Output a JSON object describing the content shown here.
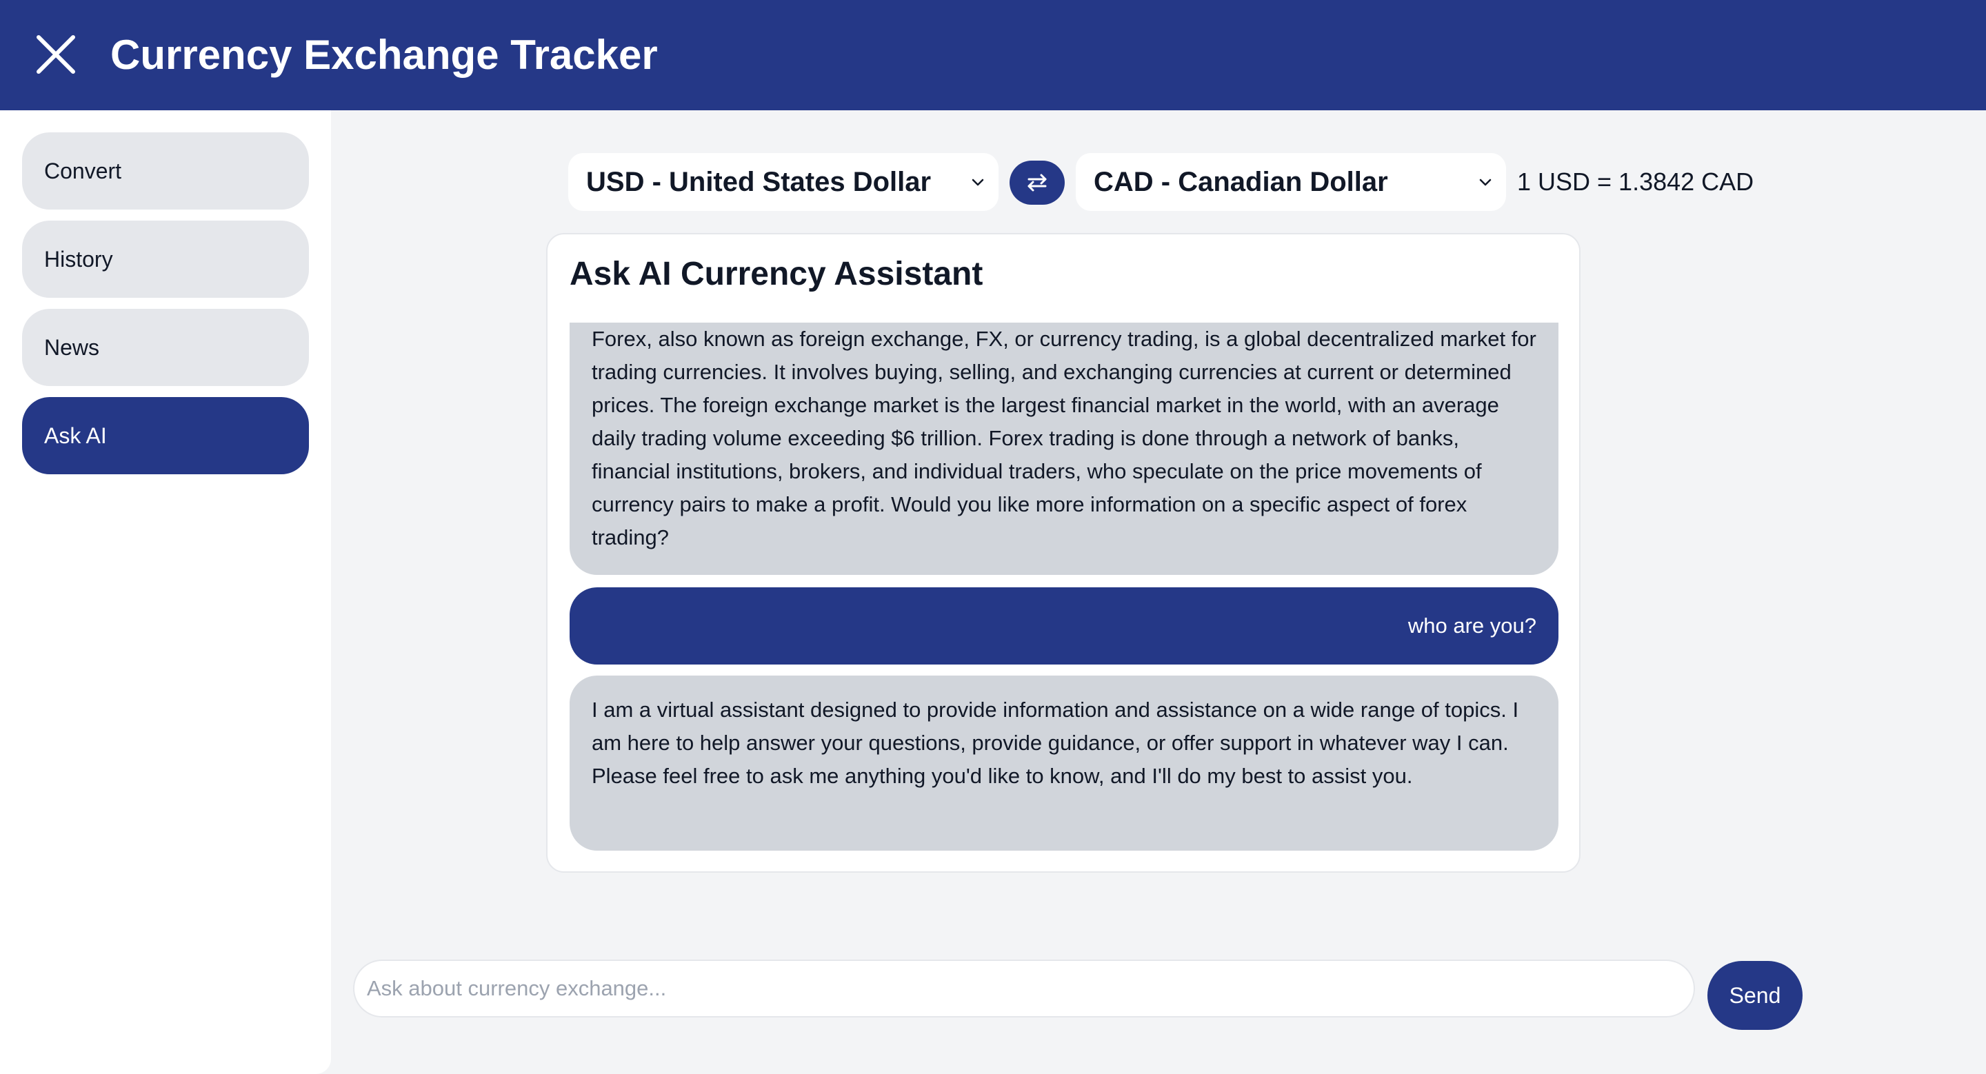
{
  "header": {
    "title": "Currency Exchange Tracker",
    "close_icon": "close-icon"
  },
  "sidebar": {
    "items": [
      {
        "label": "Convert",
        "active": false
      },
      {
        "label": "History",
        "active": false
      },
      {
        "label": "News",
        "active": false
      },
      {
        "label": "Ask AI",
        "active": true
      }
    ]
  },
  "converter": {
    "from_currency": "USD - United States Dollar",
    "to_currency": "CAD - Canadian Dollar",
    "rate_text": "1 USD = 1.3842 CAD",
    "swap_icon": "swap-arrows-icon"
  },
  "chat": {
    "title": "Ask AI Currency Assistant",
    "messages": [
      {
        "role": "assistant",
        "text": "Forex, also known as foreign exchange, FX, or currency trading, is a global decentralized market for trading currencies. It involves buying, selling, and exchanging currencies at current or determined prices. The foreign exchange market is the largest financial market in the world, with an average daily trading volume exceeding $6 trillion. Forex trading is done through a network of banks, financial institutions, brokers, and individual traders, who speculate on the price movements of currency pairs to make a profit. Would you like more information on a specific aspect of forex trading?"
      },
      {
        "role": "user",
        "text": "who are you?"
      },
      {
        "role": "assistant",
        "text": "I am a virtual assistant designed to provide information and assistance on a wide range of topics. I am here to help answer your questions, provide guidance, or offer support in whatever way I can. Please feel free to ask me anything you'd like to know, and I'll do my best to assist you."
      }
    ],
    "input": {
      "value": "",
      "placeholder": "Ask about currency exchange..."
    },
    "send_label": "Send"
  },
  "colors": {
    "primary": "#253887",
    "background": "#f3f4f6",
    "surface": "#ffffff",
    "bubble_bot": "#d1d5db",
    "nav_inactive": "#e5e7eb"
  }
}
